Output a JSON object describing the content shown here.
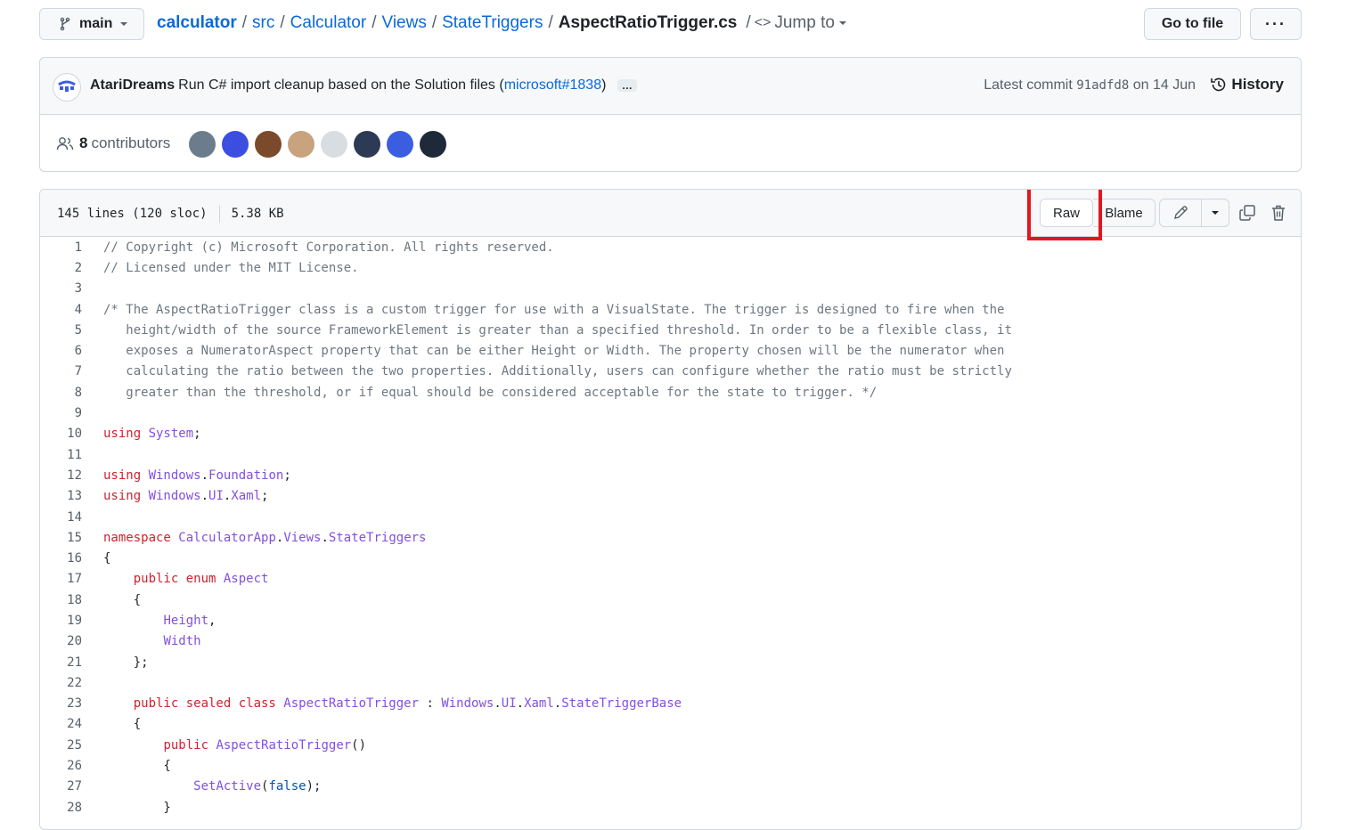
{
  "repo_nav": {
    "branch": "main",
    "breadcrumbs": [
      "calculator",
      "src",
      "Calculator",
      "Views",
      "StateTriggers"
    ],
    "file_name": "AspectRatioTrigger.cs",
    "jump_to": "Jump to",
    "go_to_file": "Go to file",
    "more": "···"
  },
  "commit": {
    "author": "AtariDreams",
    "message": "Run C# import cleanup based on the Solution files (",
    "link": "microsoft#1838",
    "message_end": ")",
    "ellipsis": "…",
    "latest_prefix": "Latest commit",
    "sha": "91adfd8",
    "date": "on 14 Jun",
    "history": "History"
  },
  "contributors": {
    "count": "8",
    "label": "contributors",
    "avatar_colors": [
      "#6b7c8c",
      "#3b4ee0",
      "#7a4a2a",
      "#c9a27e",
      "#d8dde2",
      "#2d3a55",
      "#3b5ee0",
      "#1e2a3a"
    ]
  },
  "file": {
    "lines_info": "145 lines (120 sloc)",
    "size": "5.38 KB",
    "raw": "Raw",
    "blame": "Blame"
  },
  "code": [
    {
      "n": "1",
      "t": [
        [
          "cm",
          "// Copyright (c) Microsoft Corporation. All rights reserved."
        ]
      ]
    },
    {
      "n": "2",
      "t": [
        [
          "cm",
          "// Licensed under the MIT License."
        ]
      ]
    },
    {
      "n": "3",
      "t": []
    },
    {
      "n": "4",
      "t": [
        [
          "cm",
          "/* The AspectRatioTrigger class is a custom trigger for use with a VisualState. The trigger is designed to fire when the"
        ]
      ]
    },
    {
      "n": "5",
      "t": [
        [
          "cm",
          "   height/width of the source FrameworkElement is greater than a specified threshold. In order to be a flexible class, it"
        ]
      ]
    },
    {
      "n": "6",
      "t": [
        [
          "cm",
          "   exposes a NumeratorAspect property that can be either Height or Width. The property chosen will be the numerator when"
        ]
      ]
    },
    {
      "n": "7",
      "t": [
        [
          "cm",
          "   calculating the ratio between the two properties. Additionally, users can configure whether the ratio must be strictly"
        ]
      ]
    },
    {
      "n": "8",
      "t": [
        [
          "cm",
          "   greater than the threshold, or if equal should be considered acceptable for the state to trigger. */"
        ]
      ]
    },
    {
      "n": "9",
      "t": []
    },
    {
      "n": "10",
      "t": [
        [
          "kw",
          "using "
        ],
        [
          "ty",
          "System"
        ],
        [
          "",
          "; "
        ]
      ]
    },
    {
      "n": "11",
      "t": []
    },
    {
      "n": "12",
      "t": [
        [
          "kw",
          "using "
        ],
        [
          "ty",
          "Windows"
        ],
        [
          "",
          "."
        ],
        [
          "ty",
          "Foundation"
        ],
        [
          "",
          ";"
        ]
      ]
    },
    {
      "n": "13",
      "t": [
        [
          "kw",
          "using "
        ],
        [
          "ty",
          "Windows"
        ],
        [
          "",
          "."
        ],
        [
          "ty",
          "UI"
        ],
        [
          "",
          "."
        ],
        [
          "ty",
          "Xaml"
        ],
        [
          "",
          ";"
        ]
      ]
    },
    {
      "n": "14",
      "t": []
    },
    {
      "n": "15",
      "t": [
        [
          "kw",
          "namespace "
        ],
        [
          "ty",
          "CalculatorApp"
        ],
        [
          "",
          "."
        ],
        [
          "ty",
          "Views"
        ],
        [
          "",
          "."
        ],
        [
          "ty",
          "StateTriggers"
        ]
      ]
    },
    {
      "n": "16",
      "t": [
        [
          "",
          "{"
        ]
      ]
    },
    {
      "n": "17",
      "t": [
        [
          "",
          "    "
        ],
        [
          "kw",
          "public enum "
        ],
        [
          "ty",
          "Aspect"
        ]
      ]
    },
    {
      "n": "18",
      "t": [
        [
          "",
          "    {"
        ]
      ]
    },
    {
      "n": "19",
      "t": [
        [
          "",
          "        "
        ],
        [
          "ty",
          "Height"
        ],
        [
          "",
          ","
        ]
      ]
    },
    {
      "n": "20",
      "t": [
        [
          "",
          "        "
        ],
        [
          "ty",
          "Width"
        ]
      ]
    },
    {
      "n": "21",
      "t": [
        [
          "",
          "    };"
        ]
      ]
    },
    {
      "n": "22",
      "t": []
    },
    {
      "n": "23",
      "t": [
        [
          "",
          "    "
        ],
        [
          "kw",
          "public sealed class "
        ],
        [
          "ty",
          "AspectRatioTrigger"
        ],
        [
          "",
          " : "
        ],
        [
          "ty",
          "Windows"
        ],
        [
          "",
          "."
        ],
        [
          "ty",
          "UI"
        ],
        [
          "",
          "."
        ],
        [
          "ty",
          "Xaml"
        ],
        [
          "",
          "."
        ],
        [
          "ty",
          "StateTriggerBase"
        ]
      ]
    },
    {
      "n": "24",
      "t": [
        [
          "",
          "    {"
        ]
      ]
    },
    {
      "n": "25",
      "t": [
        [
          "",
          "        "
        ],
        [
          "kw",
          "public "
        ],
        [
          "ty",
          "AspectRatioTrigger"
        ],
        [
          "",
          "()"
        ]
      ]
    },
    {
      "n": "26",
      "t": [
        [
          "",
          "        {"
        ]
      ]
    },
    {
      "n": "27",
      "t": [
        [
          "",
          "            "
        ],
        [
          "ty",
          "SetActive"
        ],
        [
          "",
          "("
        ],
        [
          "nm",
          "false"
        ],
        [
          "",
          ");"
        ]
      ]
    },
    {
      "n": "28",
      "t": [
        [
          "",
          "        }"
        ]
      ]
    }
  ]
}
